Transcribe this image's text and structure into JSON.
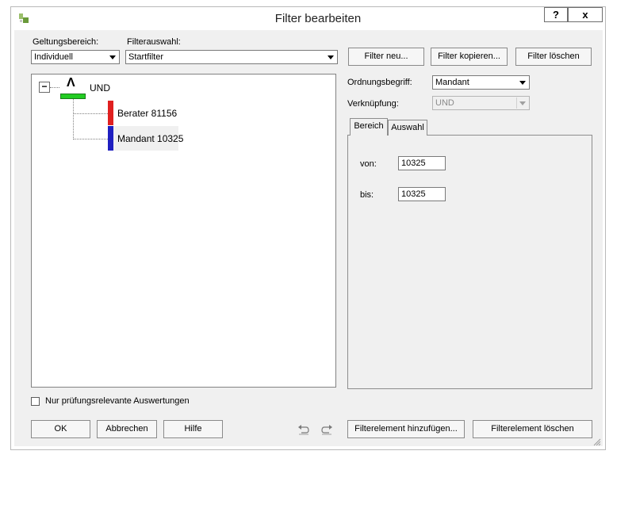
{
  "window": {
    "title": "Filter bearbeiten",
    "help_label": "?",
    "close_label": "x"
  },
  "scope": {
    "label": "Geltungsbereich:",
    "value": "Individuell"
  },
  "filter_select": {
    "label": "Filterauswahl:",
    "value": "Startfilter"
  },
  "filter_buttons": {
    "new": "Filter neu...",
    "copy": "Filter kopieren...",
    "delete": "Filter löschen"
  },
  "tree": {
    "root_operator": "Λ",
    "root_label": "UND",
    "collapse_symbol": "−",
    "root_color": "#22cc22",
    "children": [
      {
        "label": "Berater 81156",
        "color": "#e02020"
      },
      {
        "label": "Mandant 10325",
        "color": "#1f1fc0"
      }
    ]
  },
  "properties": {
    "ordering_label": "Ordnungsbegriff:",
    "ordering_value": "Mandant",
    "link_label": "Verknüpfung:",
    "link_value": "UND"
  },
  "tabs": [
    {
      "label": "Bereich"
    },
    {
      "label": "Auswahl"
    }
  ],
  "range": {
    "from_label": "von:",
    "from_value": "10325",
    "to_label": "bis:",
    "to_value": "10325"
  },
  "checkbox": {
    "label": "Nur prüfungsrelevante Auswertungen",
    "checked": false
  },
  "footer_buttons": {
    "ok": "OK",
    "cancel": "Abbrechen",
    "help": "Hilfe",
    "add_element": "Filterelement hinzufügen...",
    "delete_element": "Filterelement löschen"
  }
}
